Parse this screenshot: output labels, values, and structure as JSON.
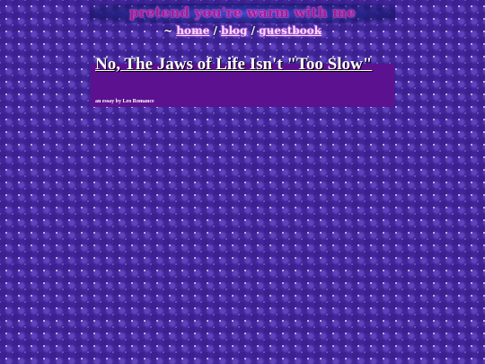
{
  "header": {
    "site_title": "pretend you're warm with me"
  },
  "nav": {
    "prefix": "~",
    "home_label": "home",
    "blog_label": "blog",
    "guestbook_label": "guestbook",
    "separator": "/"
  },
  "article": {
    "title": "No, The Jaws of Life Isn't \"Too Slow\"",
    "byline": "an essay by Leo Romance"
  },
  "colors": {
    "background": "#3a2090",
    "title_box": "#5c1190",
    "site_title": "#9f1f8f",
    "link": "#ffd6ff"
  }
}
